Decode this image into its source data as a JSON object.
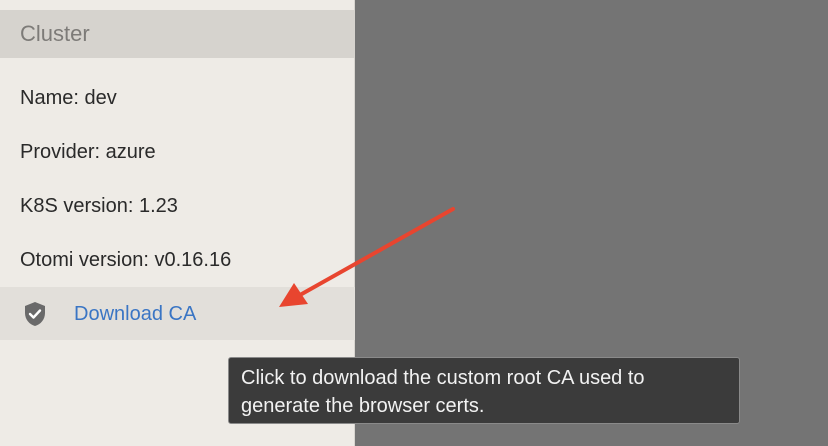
{
  "sidebar": {
    "section_title": "Cluster",
    "name": "Name: dev",
    "provider": "Provider: azure",
    "k8s_version": "K8S version: 1.23",
    "otomi_version": "Otomi version: v0.16.16",
    "download": {
      "label": "Download CA",
      "icon": "shield-check-icon"
    }
  },
  "tooltip": {
    "line1": "Click to download the custom root CA used to",
    "line2": "generate the browser certs."
  },
  "annotation": {
    "arrow_color": "#e8452f"
  },
  "colors": {
    "link": "#3a75c4",
    "backdrop": "#747474"
  }
}
